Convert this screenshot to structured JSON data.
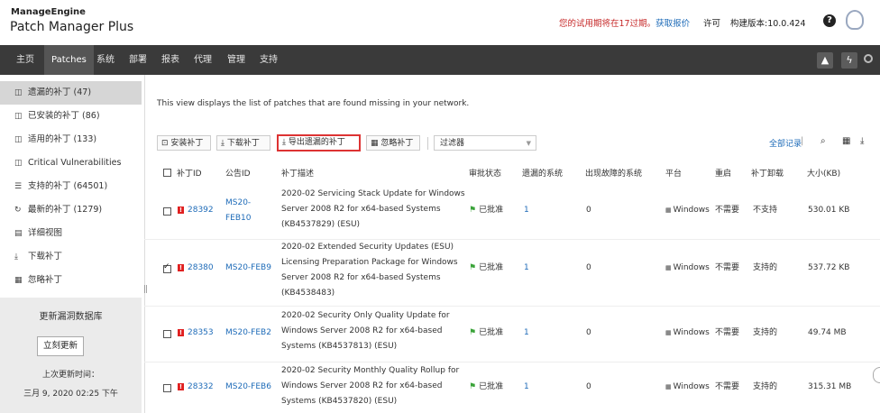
{
  "header": {
    "brand": "ManageEngine",
    "product": "Patch Manager Plus",
    "trial_prefix": "您的试用期将在17过期。",
    "trial_link": "获取报价",
    "license": "许可",
    "build": "构建版本:10.0.424",
    "help_glyph": "?"
  },
  "nav": {
    "items": [
      "主页",
      "Patches",
      "系统",
      "部署",
      "报表",
      "代理",
      "管理",
      "支持"
    ],
    "active": "Patches",
    "rocket_glyph": "▲",
    "bolt_glyph": "ϟ"
  },
  "sidebar": {
    "items": [
      {
        "icon": "missing-patches-icon",
        "glyph": "◫",
        "label": "遗漏的补丁 (47)"
      },
      {
        "icon": "installed-patches-icon",
        "glyph": "◫",
        "label": "已安装的补丁 (86)"
      },
      {
        "icon": "applicable-patches-icon",
        "glyph": "◫",
        "label": "适用的补丁 (133)"
      },
      {
        "icon": "critical-vulnerabilities-icon",
        "glyph": "◫",
        "label": "Critical Vulnerabilities"
      },
      {
        "icon": "supported-patches-icon",
        "glyph": "☰",
        "label": "支持的补丁 (64501)"
      },
      {
        "icon": "latest-patches-icon",
        "glyph": "↻",
        "label": "最新的补丁 (1279)"
      },
      {
        "icon": "detail-view-icon",
        "glyph": "▤",
        "label": "详细视图"
      },
      {
        "icon": "download-patch-icon",
        "glyph": "⤓",
        "label": "下载补丁"
      },
      {
        "icon": "ignore-patch-icon",
        "glyph": "▦",
        "label": "忽略补丁"
      }
    ],
    "panel": {
      "title": "更新漏洞数据库",
      "button": "立刻更新",
      "last_update_label": "上次更新时间：",
      "last_update_value": "三月 9, 2020 02:25 下午"
    }
  },
  "main": {
    "description": "This view displays the list of patches that are found missing in your network.",
    "toolbar": {
      "install": "安装补丁",
      "download": "下载补丁",
      "export": "导出遗漏的补丁",
      "ignore": "忽略补丁",
      "filter": "过滤器",
      "all_records": "全部记录",
      "install_glyph": "⊡",
      "download_glyph": "⤓",
      "export_glyph": "⤓",
      "ignore_glyph": "▦",
      "search_glyph": "⌕",
      "columns_glyph": "▦",
      "export_icon_glyph": "⤓",
      "caret_glyph": "▼"
    },
    "columns": [
      "补丁ID",
      "公告ID",
      "补丁描述",
      "审批状态",
      "遗漏的系统",
      "出现故障的系统",
      "平台",
      "重启",
      "补丁卸载",
      "大小(KB)"
    ],
    "rows": [
      {
        "checked": false,
        "patch_id": "28392",
        "bulletin": [
          "MS20-",
          "FEB10"
        ],
        "description": [
          "2020-02 Servicing Stack Update for Windows",
          "Server 2008 R2 for x64-based Systems",
          "(KB4537829) (ESU)"
        ],
        "approval": "已批准",
        "missing": "1",
        "failed": "0",
        "platform": "Windows",
        "reboot": "不需要",
        "uninstall": "不支持",
        "size": "530.01 KB"
      },
      {
        "checked": true,
        "patch_id": "28380",
        "bulletin": [
          "MS20-FEB9"
        ],
        "description": [
          "2020-02 Extended Security Updates (ESU)",
          "Licensing Preparation Package for Windows",
          "Server 2008 R2 for x64-based Systems",
          "(KB4538483)"
        ],
        "approval": "已批准",
        "missing": "1",
        "failed": "0",
        "platform": "Windows",
        "reboot": "不需要",
        "uninstall": "支持的",
        "size": "537.72 KB"
      },
      {
        "checked": false,
        "patch_id": "28353",
        "bulletin": [
          "MS20-FEB2"
        ],
        "description": [
          "2020-02 Security Only Quality Update for",
          "Windows Server 2008 R2 for x64-based",
          "Systems (KB4537813) (ESU)"
        ],
        "approval": "已批准",
        "missing": "1",
        "failed": "0",
        "platform": "Windows",
        "reboot": "不需要",
        "uninstall": "支持的",
        "size": "49.74 MB"
      },
      {
        "checked": false,
        "patch_id": "28332",
        "bulletin": [
          "MS20-FEB6"
        ],
        "description": [
          "2020-02 Security Monthly Quality Rollup for",
          "Windows Server 2008 R2 for x64-based",
          "Systems (KB4537820) (ESU)"
        ],
        "approval": "已批准",
        "missing": "1",
        "failed": "0",
        "platform": "Windows",
        "reboot": "不需要",
        "uninstall": "支持的",
        "size": "315.31 MB"
      }
    ]
  }
}
